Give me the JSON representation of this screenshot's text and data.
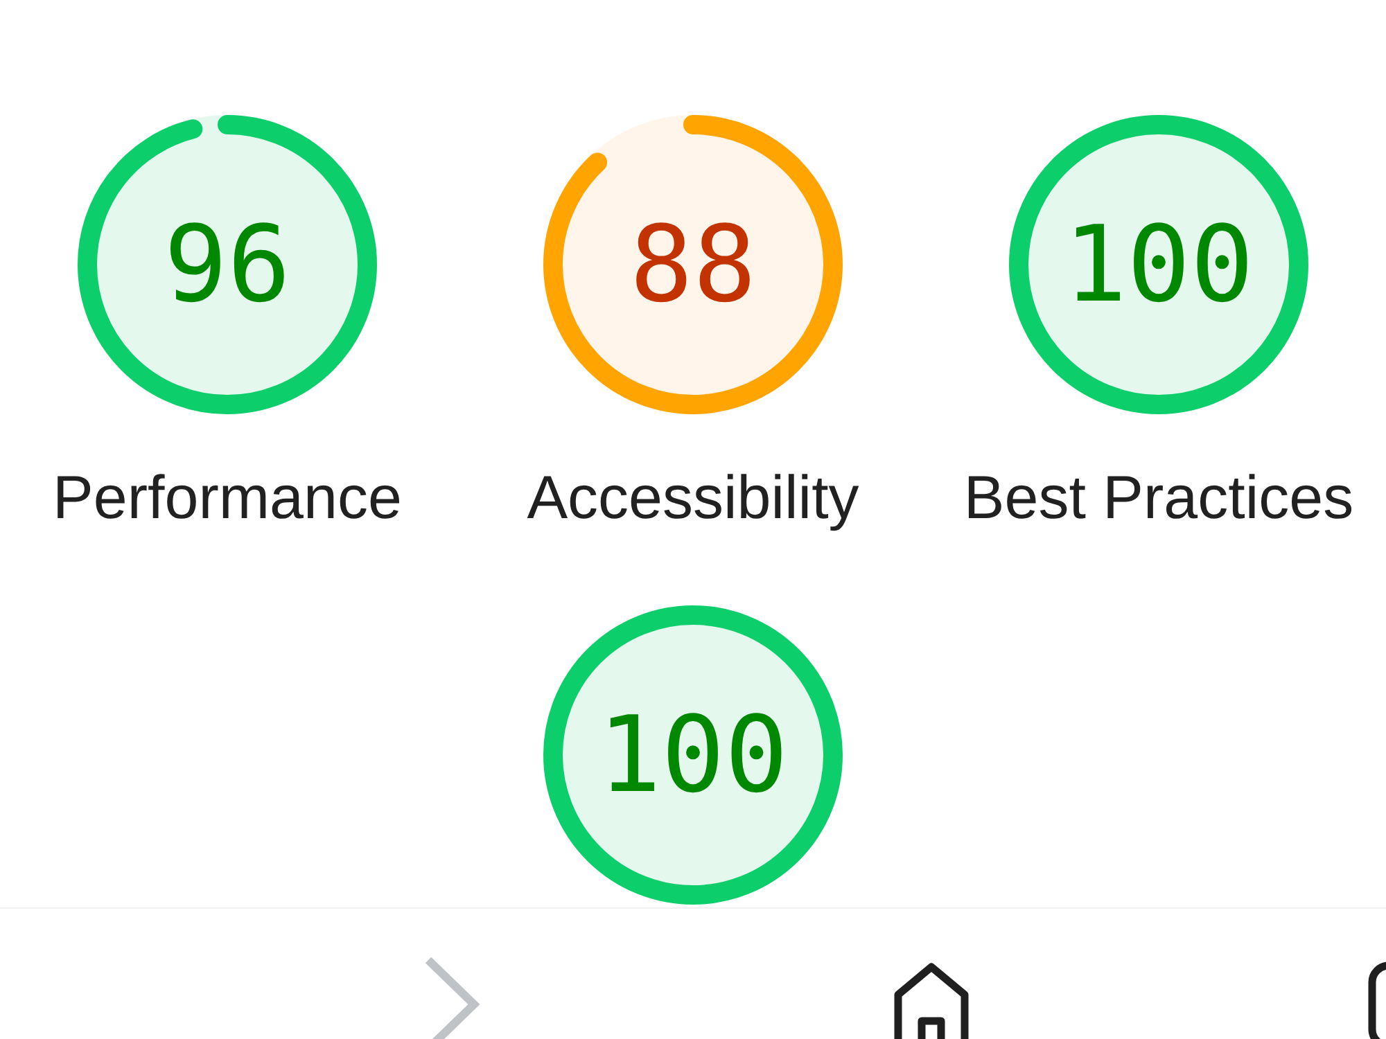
{
  "categories": [
    {
      "score": "96",
      "label": "Performance",
      "level": 0.96
    },
    {
      "score": "88",
      "label": "Accessibility",
      "level": 0.88
    },
    {
      "score": "100",
      "label": "Best Practices",
      "level": 1
    },
    {
      "score": "100",
      "level": 1
    }
  ]
}
